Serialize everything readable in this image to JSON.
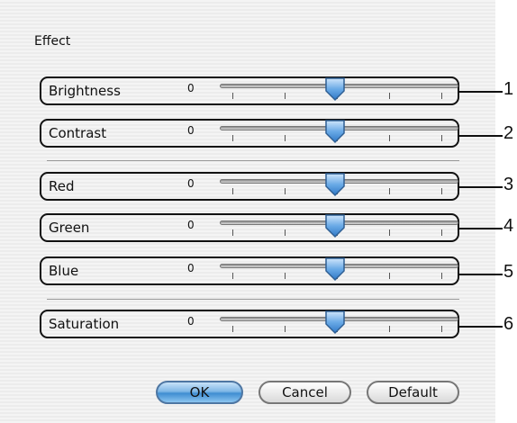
{
  "dialog": {
    "title": "Effect"
  },
  "rows": [
    {
      "label": "Brightness",
      "value": "0",
      "marker": "1"
    },
    {
      "label": "Contrast",
      "value": "0",
      "marker": "2"
    },
    {
      "label": "Red",
      "value": "0",
      "marker": "3"
    },
    {
      "label": "Green",
      "value": "0",
      "marker": "4"
    },
    {
      "label": "Blue",
      "value": "0",
      "marker": "5"
    },
    {
      "label": "Saturation",
      "value": "0",
      "marker": "6"
    }
  ],
  "buttons": {
    "ok": "OK",
    "cancel": "Cancel",
    "default": "Default"
  },
  "colors": {
    "thumb": "#4a90d9",
    "default_button": "#5aa0e0"
  },
  "icons": {
    "slider_thumb": "slider-thumb-icon"
  }
}
